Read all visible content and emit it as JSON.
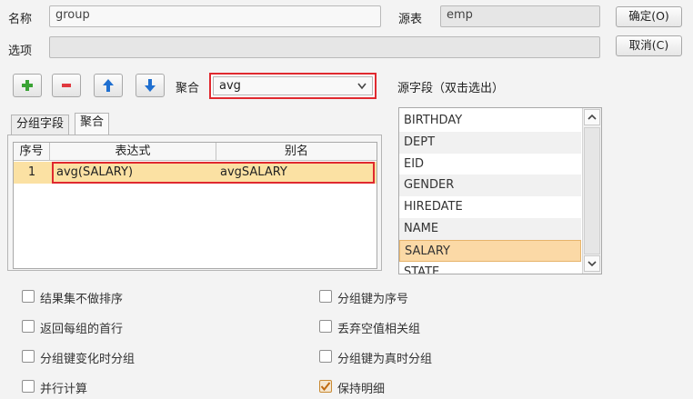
{
  "form": {
    "name_label": "名称",
    "name_value": "group",
    "source_label": "源表",
    "source_value": "emp",
    "options_label": "选项",
    "options_value": ""
  },
  "buttons": {
    "ok": "确定(O)",
    "cancel": "取消(C)"
  },
  "toolbar": {
    "aggregate_label": "聚合",
    "aggregate_selected": "avg"
  },
  "source_fields": {
    "title": "源字段（双击选出）",
    "items": [
      "BIRTHDAY",
      "DEPT",
      "EID",
      "GENDER",
      "HIREDATE",
      "NAME",
      "SALARY",
      "STATE"
    ],
    "selected": "SALARY"
  },
  "tabs": [
    "分组字段",
    "聚合"
  ],
  "active_tab": "聚合",
  "grid": {
    "columns": [
      "序号",
      "表达式",
      "别名"
    ],
    "rows": [
      {
        "index": "1",
        "expression": "avg(SALARY)",
        "alias": "avgSALARY"
      }
    ]
  },
  "checkboxes": [
    {
      "label": "结果集不做排序",
      "checked": false
    },
    {
      "label": "分组键为序号",
      "checked": false
    },
    {
      "label": "返回每组的首行",
      "checked": false
    },
    {
      "label": "丢弃空值相关组",
      "checked": false
    },
    {
      "label": "分组键变化时分组",
      "checked": false
    },
    {
      "label": "分组键为真时分组",
      "checked": false
    },
    {
      "label": "并行计算",
      "checked": false
    },
    {
      "label": "保持明细",
      "checked": true
    }
  ],
  "colors": {
    "highlight_border": "#e0292f",
    "selected_row": "#fbd9a6",
    "add_icon": "#3aa335",
    "remove_icon": "#e0383e",
    "arrow_icon": "#1f6fd0"
  }
}
